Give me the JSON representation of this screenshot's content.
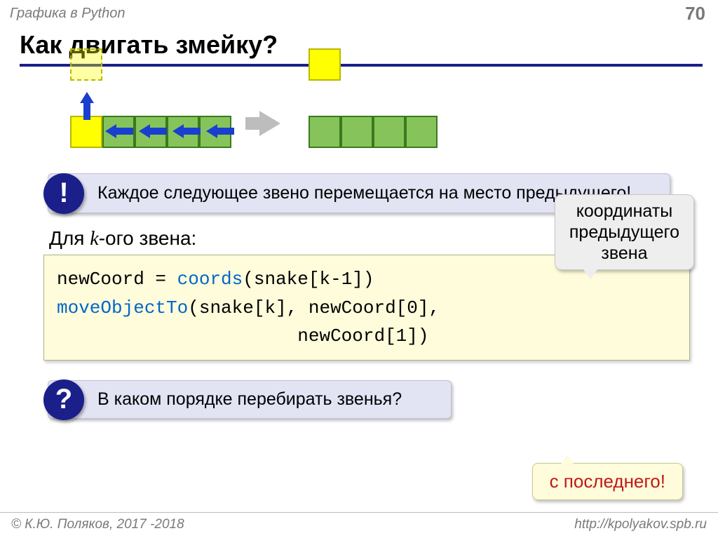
{
  "header": {
    "topic": "Графика в Python",
    "page_number": "70"
  },
  "title": "Как двигать змейку?",
  "note": {
    "badge": "!",
    "text": "Каждое следующее звено перемещается на место предыдущего!"
  },
  "for_k_prefix": "Для ",
  "for_k_var": "k",
  "for_k_suffix": "-ого звена:",
  "callout": {
    "line1": "координаты",
    "line2": "предыдущего",
    "line3": "звена"
  },
  "code": {
    "l1a": "newCoord = ",
    "l1b": "coords",
    "l1c": "(snake[k-1])",
    "l2a": "moveObjectTo",
    "l2b": "(snake[k], newCoord[0],",
    "l3": "                      newCoord[1])"
  },
  "question": {
    "badge": "?",
    "text": "В каком порядке перебирать звенья?"
  },
  "answer": "с последнего!",
  "footer": {
    "left": "© К.Ю. Поляков, 2017 -2018",
    "right": "http://kpolyakov.spb.ru"
  }
}
